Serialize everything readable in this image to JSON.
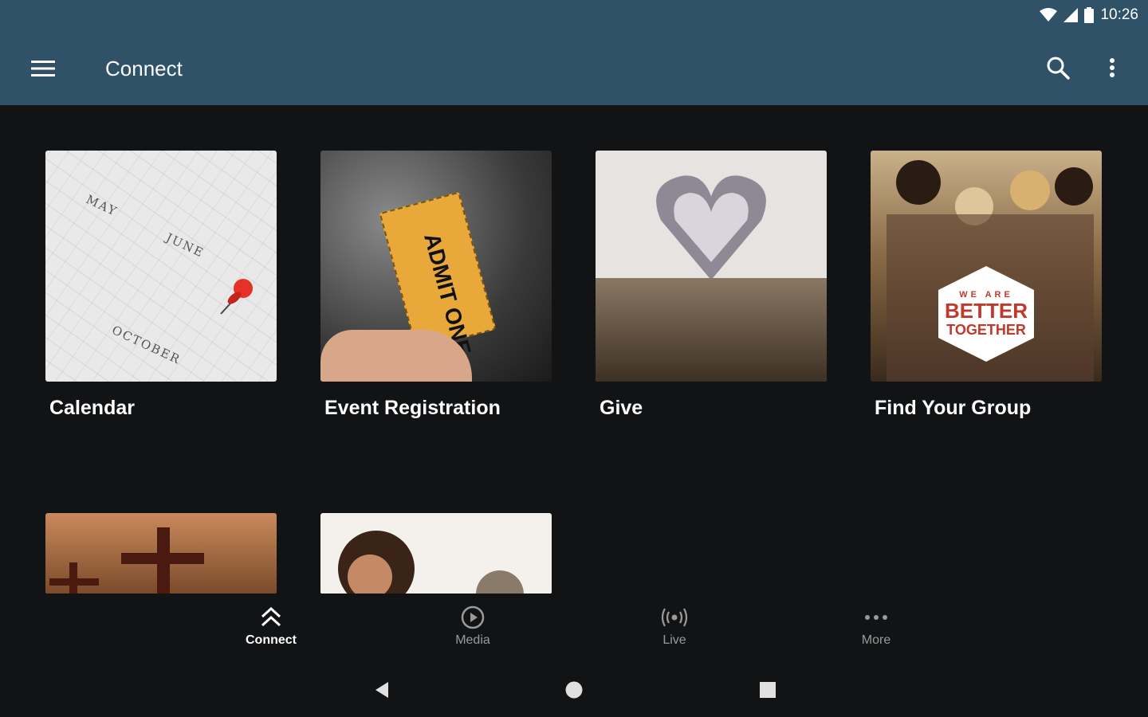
{
  "status_bar": {
    "time": "10:26",
    "icons": [
      "wifi-icon",
      "signal-icon",
      "battery-icon"
    ]
  },
  "app_bar": {
    "title": "Connect",
    "menu_icon": "hamburger-menu-icon",
    "search_icon": "search-icon",
    "overflow_icon": "more-vertical-icon",
    "color": "#2f5268"
  },
  "tiles": [
    {
      "label": "Calendar",
      "image": "calendar with red pushpin"
    },
    {
      "label": "Event Registration",
      "image": "ADMIT ONE ticket"
    },
    {
      "label": "Give",
      "image": "book pages folded into heart"
    },
    {
      "label": "Find Your Group",
      "image": "group of friends"
    },
    {
      "label": "",
      "image": "crosses at sunset"
    },
    {
      "label": "",
      "image": "smiling woman"
    }
  ],
  "image_text": {
    "calendar_words": [
      "JUNE",
      "OCTOBER",
      "MAY"
    ],
    "ticket_text": "ADMIT ONE",
    "badge": {
      "line1": "WE ARE",
      "line2": "BETTER",
      "line3": "TOGETHER"
    }
  },
  "bottom_nav": [
    {
      "label": "Connect",
      "icon": "double-chevron-up-icon",
      "active": true
    },
    {
      "label": "Media",
      "icon": "play-circle-icon",
      "active": false
    },
    {
      "label": "Live",
      "icon": "broadcast-icon",
      "active": false
    },
    {
      "label": "More",
      "icon": "more-horizontal-icon",
      "active": false
    }
  ],
  "system_nav": {
    "icons": [
      "back-icon",
      "home-icon",
      "recents-icon"
    ]
  },
  "colors": {
    "background": "#111315",
    "accent": "#2f5268"
  }
}
